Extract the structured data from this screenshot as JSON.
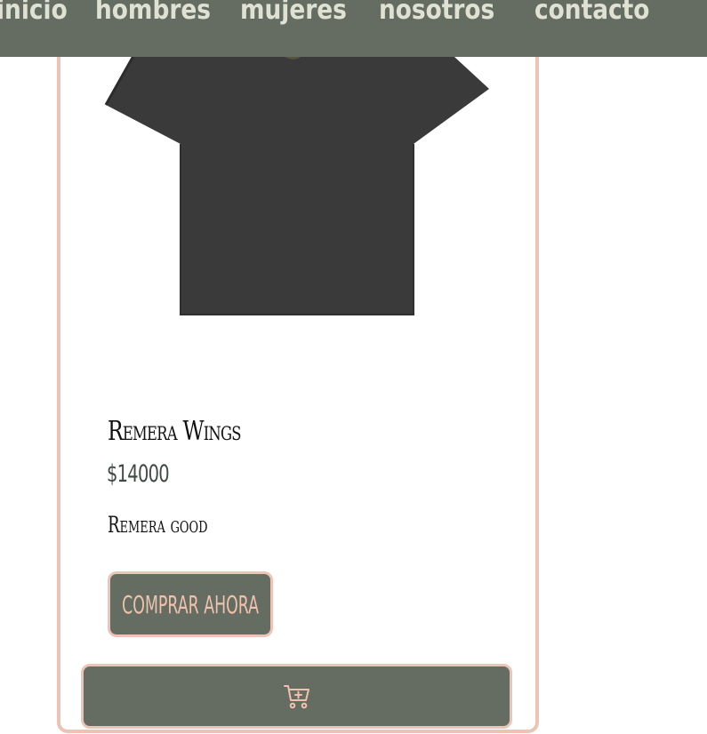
{
  "nav": {
    "items": [
      {
        "label": "inicio"
      },
      {
        "label": "Hombres"
      },
      {
        "label": "Mujeres"
      },
      {
        "label": "Nosotros"
      },
      {
        "label": "Contacto"
      }
    ]
  },
  "product": {
    "name": "Remera Wings",
    "price": "$14000",
    "description": "Remera good",
    "image_icon": "black-tshirt-image",
    "buy_label": "COMPRAR AHORA",
    "cart_icon": "add-to-cart-icon"
  },
  "colors": {
    "accent": "#656d63",
    "border": "#ecc3b4",
    "button_text": "#f0c2ad",
    "nav_text": "#dfe2d2",
    "price_text": "#3f4a44"
  }
}
